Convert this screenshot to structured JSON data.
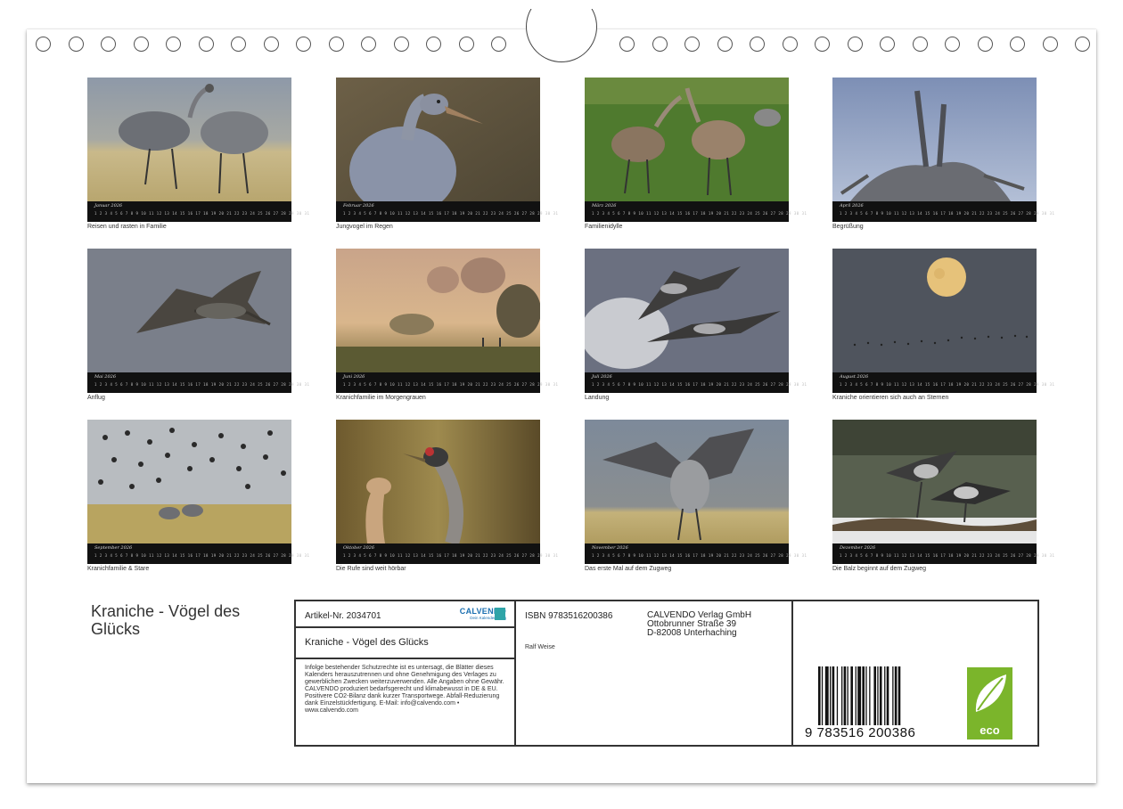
{
  "months": [
    {
      "name": "Januar 2026",
      "caption": "Reisen und rasten in Familie"
    },
    {
      "name": "Februar 2026",
      "caption": "Jungvogel im Regen"
    },
    {
      "name": "März 2026",
      "caption": "Familienidylle"
    },
    {
      "name": "April 2026",
      "caption": "Begrüßung"
    },
    {
      "name": "Mai 2026",
      "caption": "Anflug"
    },
    {
      "name": "Juni 2026",
      "caption": "Kranichfamilie im Morgengrauen"
    },
    {
      "name": "Juli 2026",
      "caption": "Landung"
    },
    {
      "name": "August 2026",
      "caption": "Kraniche orientieren sich auch an Sternen"
    },
    {
      "name": "September 2026",
      "caption": "Kranichfamilie & Stare"
    },
    {
      "name": "Oktober 2026",
      "caption": "Die Rufe sind weit hörbar"
    },
    {
      "name": "November 2026",
      "caption": "Das erste Mal auf dem Zugweg"
    },
    {
      "name": "Dezember 2026",
      "caption": "Die Balz beginnt auf dem Zugweg"
    }
  ],
  "calendar_days": "1 2 3 4 5 6 7 8 9 10 11 12 13 14 15 16 17 18 19 20 21 22 23 24 25 26 27 28 29 30 31",
  "title": "Kraniche - Vögel des Glücks",
  "info": {
    "article": "Artikel-Nr. 2034701",
    "logo": "CALVENDO",
    "logo_sub": "Dein Kalenderverlag",
    "product_title": "Kraniche - Vögel des Glücks",
    "legal": "Infolge bestehender Schutzrechte ist es untersagt, die Blätter dieses Kalenders herauszutrennen und ohne Genehmigung des Verlages zu gewerblichen Zwecken weiterzuverwenden. Alle Angaben ohne Gewähr. CALVENDO produziert bedarfsgerecht und klimabewusst in DE & EU. Positivere CO2-Bilanz dank kurzer Transportwege. Abfall-Reduzierung dank Einzelstückfertigung. E-Mail: info@calvendo.com • www.calvendo.com",
    "isbn": "ISBN 9783516200386",
    "author": "Ralf Weise",
    "publisher_line1": "CALVENDO Verlag GmbH",
    "publisher_line2": "Ottobrunner Straße 39",
    "publisher_line3": "D-82008 Unterhaching",
    "barcode_number": "9  783516  200386",
    "eco_label": "eco"
  },
  "colors": {
    "eco_green": "#7bb52b",
    "calendar_bar": "#111111",
    "logo_blue": "#1a6fb0"
  }
}
